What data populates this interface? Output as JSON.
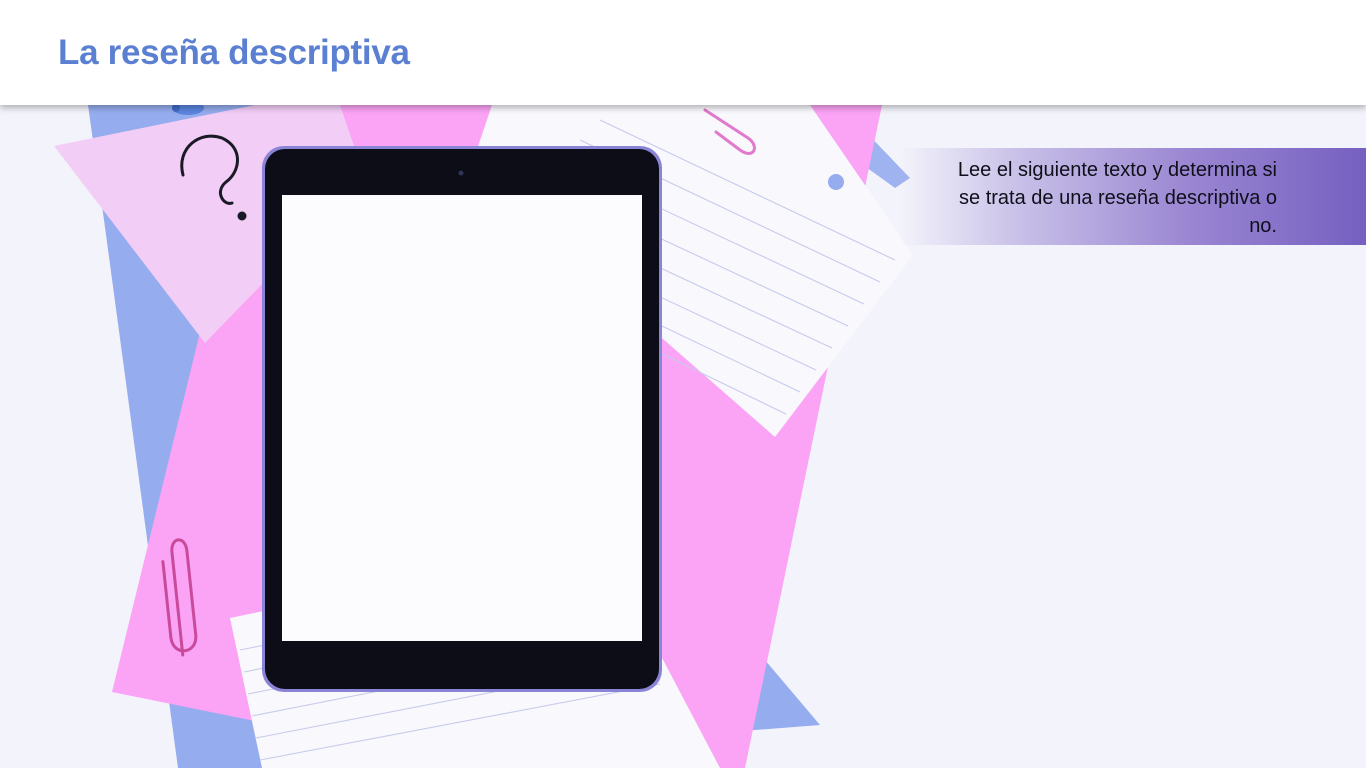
{
  "slide": {
    "title": "La reseña descriptiva",
    "instruction": "Lee el siguiente texto y determina si se trata de una reseña descriptiva o no."
  },
  "scene": {
    "icons": [
      "question-mark-icon",
      "paperclip-icon",
      "pushpin-icon"
    ],
    "tablet_screen_text": ""
  },
  "colors": {
    "title": "#5b7fd1",
    "background": "#f3f3fb",
    "header_background": "#ffffff",
    "pink_paper": "#fba3f5",
    "blue_paper": "#95acee",
    "light_pink_note": "#f2cdf6",
    "lined_paper": "#f8f8fd",
    "tablet_bezel": "#0d0d17",
    "band_end": "#7560c0"
  }
}
